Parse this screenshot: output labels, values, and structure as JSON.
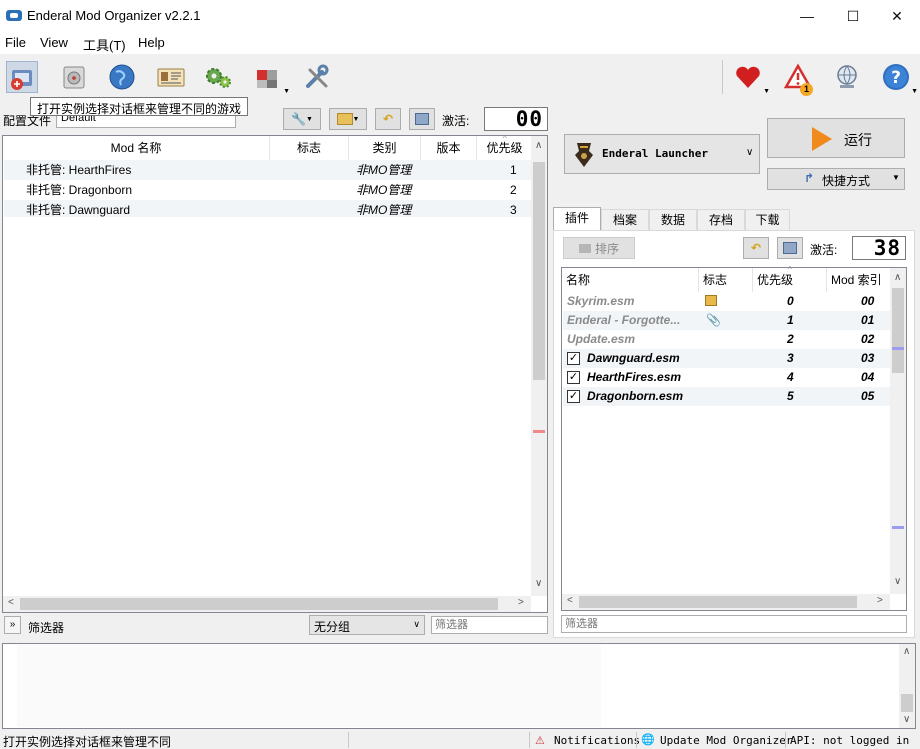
{
  "window": {
    "title": "Enderal Mod Organizer v2.2.1",
    "minimize_glyph": "—",
    "maximize_glyph": "☐",
    "close_glyph": "✕"
  },
  "menu": [
    "File",
    "View",
    "工具(T)",
    "Help"
  ],
  "toolbar": {
    "icons": [
      "change-instance-icon",
      "archive-disk-icon",
      "browse-nexus-icon",
      "id-card-icon",
      "settings-gears-icon",
      "executables-puzzle-icon",
      "tools-wrench-icon",
      "endorse-heart-icon",
      "notifications-warning-icon",
      "update-globe-icon",
      "help-icon"
    ],
    "warning_badge": "1",
    "tooltip": "打开实例选择对话框来管理不同的游戏"
  },
  "left_panel": {
    "profile_label": "配置文件",
    "profile_value": "Default",
    "active_label": "激活:",
    "active_count": "00",
    "columns": [
      "Mod 名称",
      "标志",
      "类别",
      "版本",
      "优先级"
    ],
    "mods": [
      {
        "name": "非托管: HearthFires",
        "category": "非MO管理",
        "priority": "1"
      },
      {
        "name": "非托管: Dragonborn",
        "category": "非MO管理",
        "priority": "2"
      },
      {
        "name": "非托管: Dawnguard",
        "category": "非MO管理",
        "priority": "3"
      }
    ],
    "filter_label": "筛选器",
    "group_value": "无分组",
    "filter_placeholder": "筛选器"
  },
  "right_panel": {
    "launcher": "Enderal Launcher",
    "run_label": "运行",
    "shortcut_label": "快捷方式",
    "tabs": [
      "插件",
      "档案",
      "数据",
      "存档",
      "下载"
    ],
    "sort_label": "排序",
    "active_label": "激活:",
    "active_count": "38",
    "columns": [
      "名称",
      "标志",
      "优先级",
      "Mod 索引"
    ],
    "plugins": [
      {
        "name": "Skyrim.esm",
        "priority": "0",
        "index": "00",
        "checked": false,
        "flag": "package-icon"
      },
      {
        "name": "Enderal - Forgotte...",
        "priority": "1",
        "index": "01",
        "checked": false,
        "flag": "paperclip-icon"
      },
      {
        "name": "Update.esm",
        "priority": "2",
        "index": "02",
        "checked": false,
        "flag": ""
      },
      {
        "name": "Dawnguard.esm",
        "priority": "3",
        "index": "03",
        "checked": true,
        "flag": ""
      },
      {
        "name": "HearthFires.esm",
        "priority": "4",
        "index": "04",
        "checked": true,
        "flag": ""
      },
      {
        "name": "Dragonborn.esm",
        "priority": "5",
        "index": "05",
        "checked": true,
        "flag": ""
      }
    ],
    "filter_placeholder": "筛选器"
  },
  "status_bar": {
    "message": "打开实例选择对话框来管理不同",
    "notifications": "Notifications",
    "update": "Update Mod Organizer",
    "api": "API: not logged in"
  }
}
